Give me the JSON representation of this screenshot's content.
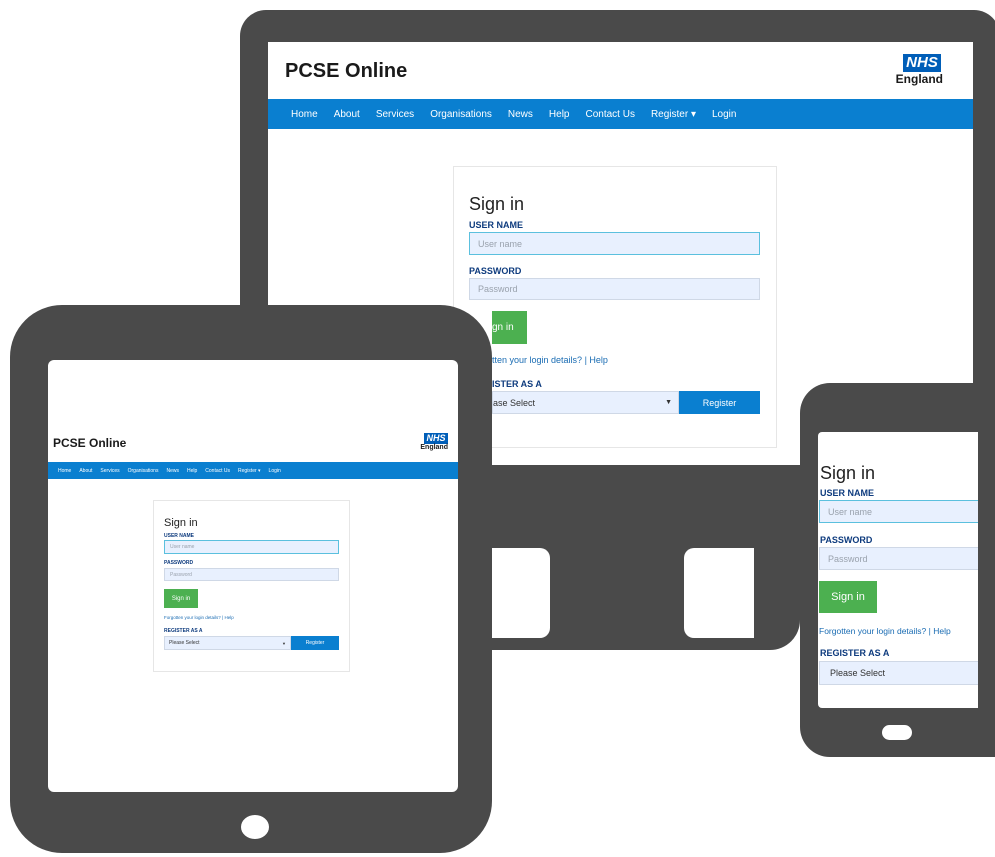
{
  "brand": {
    "title": "PCSE Online",
    "nhs_logo": "NHS",
    "nhs_region": "England"
  },
  "nav": [
    "Home",
    "About",
    "Services",
    "Organisations",
    "News",
    "Help",
    "Contact Us",
    "Register ▾",
    "Login"
  ],
  "signin": {
    "heading": "Sign in",
    "username_label": "USER NAME",
    "username_placeholder": "User name",
    "password_label": "PASSWORD",
    "password_placeholder": "Password",
    "button": "Sign in",
    "forgot_link": "Forgotten your login details?",
    "separator": " | ",
    "help_link": "Help",
    "register_label": "REGISTER AS A",
    "register_select": "Please Select",
    "register_button": "Register"
  },
  "desktop_cropped": {
    "button": "gn in",
    "forgot_link": "tten your login details?",
    "register_label": "ISTER AS A",
    "register_select": "ase Select"
  },
  "colors": {
    "device": "#4a4a4a",
    "nav": "#0a7fd0",
    "green": "#4cb050",
    "nhs_blue": "#005eb8",
    "label": "#0e3b7e",
    "input_bg": "#e8f0fe"
  }
}
